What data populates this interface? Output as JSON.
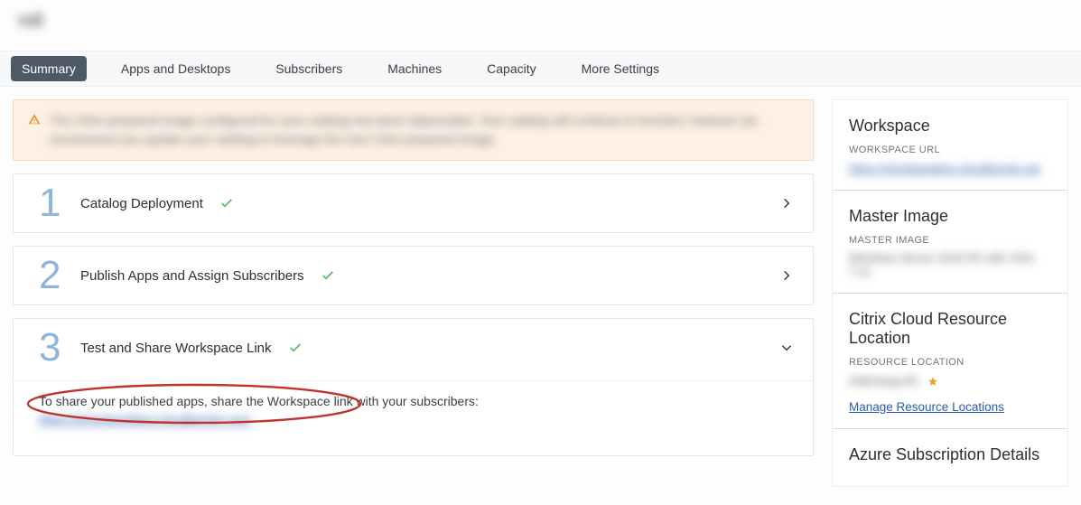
{
  "header": {
    "title": "rs8"
  },
  "tabs": {
    "items": [
      {
        "label": "Summary",
        "active": true
      },
      {
        "label": "Apps and Desktops",
        "active": false
      },
      {
        "label": "Subscribers",
        "active": false
      },
      {
        "label": "Machines",
        "active": false
      },
      {
        "label": "Capacity",
        "active": false
      },
      {
        "label": "More Settings",
        "active": false
      }
    ]
  },
  "alert": {
    "text": "The Citrix-prepared image configured for your catalog has been deprecated. Your catalog will continue to function; however we recommend you update your catalog to leverage the new Citrix-prepared image."
  },
  "steps": [
    {
      "num": "1",
      "title": "Catalog Deployment",
      "done": true,
      "expanded": false
    },
    {
      "num": "2",
      "title": "Publish Apps and Assign Subscribers",
      "done": true,
      "expanded": false
    },
    {
      "num": "3",
      "title": "Test and Share Workspace Link",
      "done": true,
      "expanded": true
    }
  ],
  "share": {
    "text": "To share your published apps, share the Workspace link with your subscribers:",
    "url": "https://christiansblog.cloudburrito.com"
  },
  "side": {
    "workspace": {
      "heading": "Workspace",
      "sub": "WORKSPACE URL",
      "url": "https://christiansblog.cloudburrito.net"
    },
    "master": {
      "heading": "Master Image",
      "sub": "MASTER IMAGE",
      "value": "Windows Server 2016 R2 with VDA 7.xx"
    },
    "location": {
      "heading": "Citrix Cloud Resource Location",
      "sub": "RESOURCE LOCATION",
      "value": "tridentaug-RL",
      "link": "Manage Resource Locations"
    },
    "azure": {
      "heading": "Azure Subscription Details"
    }
  }
}
